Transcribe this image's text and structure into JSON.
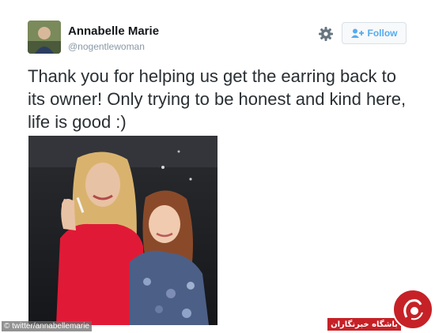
{
  "user": {
    "name": "Annabelle Marie",
    "handle": "@nogentlewoman",
    "avatar_icon": "profile-photo"
  },
  "actions": {
    "settings_icon": "gear-icon",
    "follow_label": "Follow",
    "follow_icon": "add-user-icon",
    "accent_color": "#55acee"
  },
  "tweet": {
    "text": "Thank you for helping us get the earring back to its owner! Only trying to be honest and kind here, life is good :)"
  },
  "photo": {
    "credit": "© twitter/annabellemarie"
  },
  "watermark": {
    "text": "باشگاه خبرنگاران",
    "color": "#c62127"
  }
}
